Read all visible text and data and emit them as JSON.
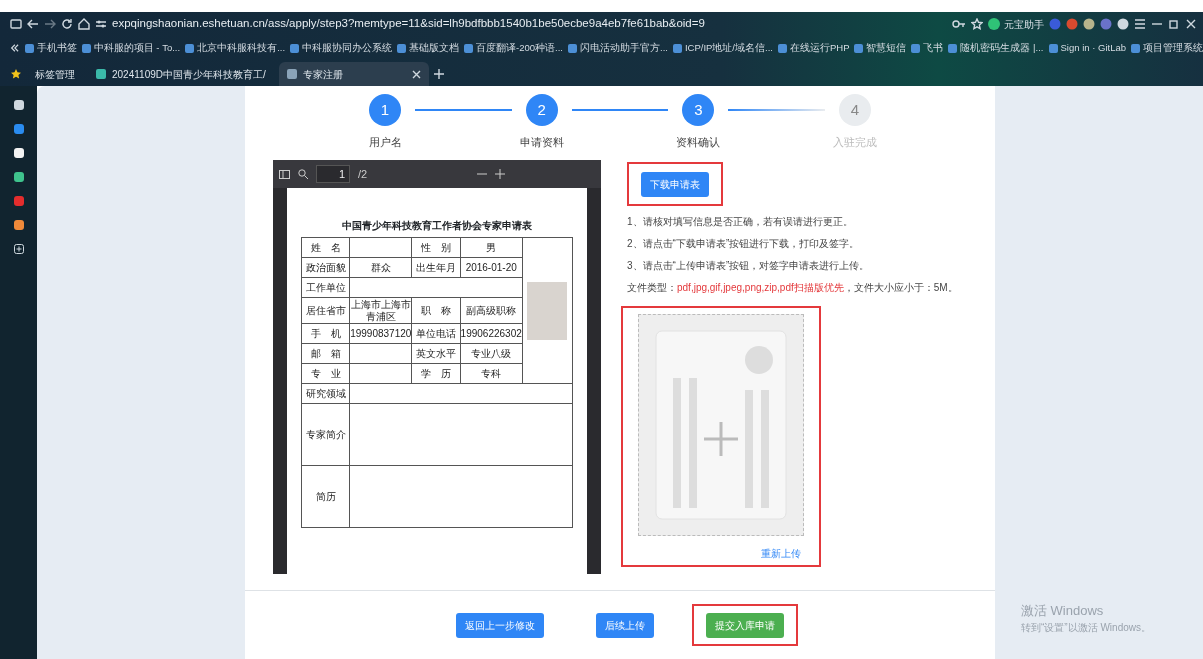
{
  "browser": {
    "url": "expqingshaonian.eshetuan.cn/ass/apply/step3?memtype=11&sid=lh9bdfbbb1540b1be50ecbe9a4eb7fe61bab&oid=9",
    "assistant": "元宝助手",
    "bookmarks": [
      {
        "label": "手机书签"
      },
      {
        "label": "中科服的项目 - To..."
      },
      {
        "label": "北京中科服科技有..."
      },
      {
        "label": "中科服协同办公系统"
      },
      {
        "label": "基础版文档"
      },
      {
        "label": "百度翻译-200种语..."
      },
      {
        "label": "闪电活动助手官方..."
      },
      {
        "label": "ICP/IP地址/域名信..."
      },
      {
        "label": "在线运行PHP"
      },
      {
        "label": "智慧短信"
      },
      {
        "label": "飞书"
      },
      {
        "label": "随机密码生成器 |..."
      },
      {
        "label": "Sign in · GitLab"
      },
      {
        "label": "项目管理系统"
      }
    ],
    "tab_group": "标签管理",
    "tabs": [
      {
        "label": "20241109D中国青少年科技教育工/",
        "selected": false
      },
      {
        "label": "专家注册",
        "selected": true
      }
    ]
  },
  "steps": [
    {
      "number": "1",
      "label": "用户名",
      "done": true
    },
    {
      "number": "2",
      "label": "申请资料",
      "done": true
    },
    {
      "number": "3",
      "label": "资料确认",
      "done": true
    },
    {
      "number": "4",
      "label": "入驻完成",
      "done": false
    }
  ],
  "pdf_viewer": {
    "page": "1",
    "page_count": "/2",
    "title": "中国青少年科技教育工作者协会专家申请表",
    "rows": [
      [
        {
          "text": "姓　名"
        },
        {},
        {
          "text": "性　别"
        },
        {
          "text": "男"
        }
      ],
      [
        {
          "text": "政治面貌"
        },
        {
          "text": "群众"
        },
        {
          "text": "出生年月"
        },
        {
          "text": "2016-01-20"
        }
      ],
      [
        {
          "text": "工作单位"
        },
        {}
      ],
      [
        {
          "text": "居住省市"
        },
        {
          "text": "上海市上海市青浦区"
        },
        {
          "text": "职　称"
        },
        {
          "text": "副高级职称"
        }
      ],
      [
        {
          "text": "手　机"
        },
        {
          "text": "19990837120"
        },
        {
          "text": "单位电话"
        },
        {
          "text": "19906226302"
        }
      ],
      [
        {
          "text": "邮　箱"
        },
        {},
        {
          "text": "英文水平"
        },
        {
          "text": "专业八级"
        }
      ],
      [
        {
          "text": "专　业"
        },
        {},
        {
          "text": "学　历"
        },
        {
          "text": "专科"
        }
      ],
      [
        {
          "text": "研究领域"
        },
        {}
      ],
      [
        {
          "text": "专家简介"
        },
        {
          "tall": true
        }
      ],
      [
        {
          "text": "简历"
        },
        {
          "tall": true
        }
      ]
    ]
  },
  "download_button": {
    "label": "下载申请表",
    "highlighted": true
  },
  "instructions": [
    "1、请核对填写信息是否正确，若有误请进行更正。",
    "2、请点击“下载申请表”按钮进行下载，打印及签字。",
    "3、请点击“上传申请表”按钮，对签字申请表进行上传。"
  ],
  "file_types": {
    "label": "文件类型：",
    "value": "pdf,jpg,gif,jpeg,png,zip,pdf扫描版优先",
    "suffix": "，文件大小应小于：5M。"
  },
  "upload": {
    "link": "重新上传",
    "highlighted": true
  },
  "footer_buttons": [
    {
      "label": "返回上一步修改",
      "kind": "primary",
      "highlighted": false
    },
    {
      "label": "后续上传",
      "kind": "primary",
      "highlighted": false
    },
    {
      "label": "提交入库申请",
      "kind": "success",
      "highlighted": true
    }
  ],
  "os_notice": {
    "title": "激活 Windows",
    "text": "转到“设置”以激活 Windows。"
  }
}
